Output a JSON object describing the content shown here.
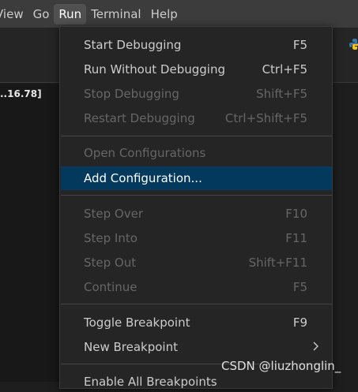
{
  "menubar": {
    "items": [
      {
        "label": "View"
      },
      {
        "label": "Go"
      },
      {
        "label": "Run"
      },
      {
        "label": "Terminal"
      },
      {
        "label": "Help"
      }
    ]
  },
  "editor": {
    "left_text": "..16.78]"
  },
  "run_menu": {
    "items": [
      {
        "label": "Start Debugging",
        "shortcut": "F5",
        "enabled": true
      },
      {
        "label": "Run Without Debugging",
        "shortcut": "Ctrl+F5",
        "enabled": true
      },
      {
        "label": "Stop Debugging",
        "shortcut": "Shift+F5",
        "enabled": false
      },
      {
        "label": "Restart Debugging",
        "shortcut": "Ctrl+Shift+F5",
        "enabled": false
      },
      {
        "label": "Open Configurations",
        "shortcut": "",
        "enabled": false
      },
      {
        "label": "Add Configuration...",
        "shortcut": "",
        "enabled": true,
        "selected": true
      },
      {
        "label": "Step Over",
        "shortcut": "F10",
        "enabled": false
      },
      {
        "label": "Step Into",
        "shortcut": "F11",
        "enabled": false
      },
      {
        "label": "Step Out",
        "shortcut": "Shift+F11",
        "enabled": false
      },
      {
        "label": "Continue",
        "shortcut": "F5",
        "enabled": false
      },
      {
        "label": "Toggle Breakpoint",
        "shortcut": "F9",
        "enabled": true
      },
      {
        "label": "New Breakpoint",
        "shortcut": "",
        "enabled": true,
        "submenu": true
      },
      {
        "label": "Enable All Breakpoints",
        "shortcut": "",
        "enabled": true
      }
    ]
  },
  "watermark": "CSDN @liuzhonglin_",
  "colors": {
    "menu_bg": "#252526",
    "selected_bg": "#04395e",
    "disabled_text": "#666666",
    "enabled_text": "#cccccc"
  }
}
